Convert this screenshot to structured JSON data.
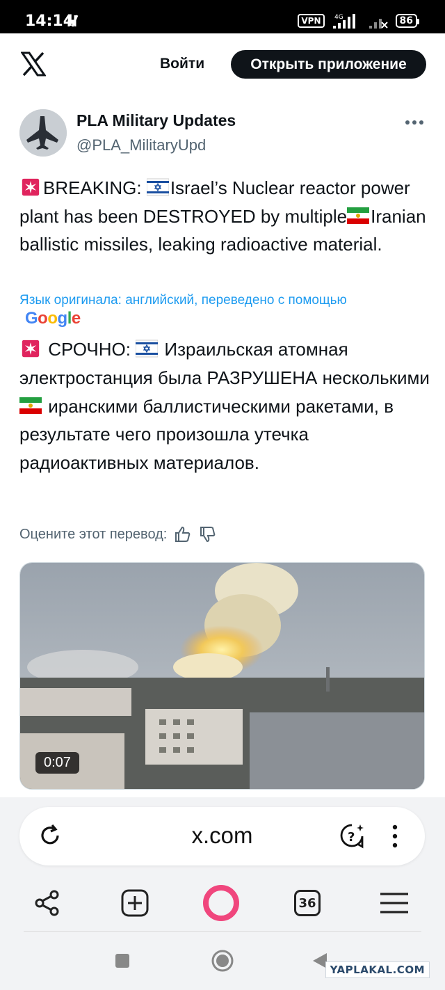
{
  "status_bar": {
    "time": "14:14",
    "vpn": "VPN",
    "network": "4G",
    "battery": "86"
  },
  "header": {
    "login_label": "Войти",
    "open_app_label": "Открыть приложение"
  },
  "tweet": {
    "display_name": "PLA Military Updates",
    "handle": "@PLA_MilitaryUpd",
    "text_parts": [
      "BREAKING: ",
      "Israel’s Nuclear reactor power plant has been DESTROYED by multiple",
      "Iranian ballistic missiles, leaking radioactive material."
    ],
    "original_language_note": "Язык оригинала: английский, переведено с помощью",
    "translator": "Google",
    "translated_parts": [
      " СРОЧНО: ",
      " Израильская атомная электростанция была РАЗРУШЕНА несколькими ",
      " иранскими баллистическими ракетами, в результате чего произошла утечка радиоактивных материалов."
    ],
    "rate_label": "Оцените этот перевод:"
  },
  "video": {
    "duration": "0:07"
  },
  "browser": {
    "url": "x.com",
    "tabs_count": "36"
  },
  "watermark": "YAPLAKAL.COM",
  "colors": {
    "link_blue": "#1d9bf0",
    "muted": "#536471",
    "accent_pink": "#f0467d"
  }
}
